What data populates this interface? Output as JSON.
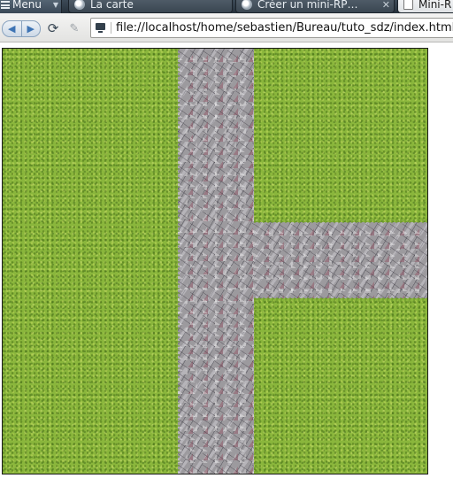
{
  "browser": {
    "menu_label": "Menu",
    "tabs": [
      {
        "label": "La carte",
        "icon": "page-icon",
        "active": false
      },
      {
        "label": "Créer un mini-RP…",
        "icon": "page-icon",
        "active": false
      },
      {
        "label": "Mini-R",
        "icon": "document-icon",
        "active": true
      }
    ],
    "toolbar": {
      "back_icon": "back-arrow-icon",
      "forward_icon": "forward-arrow-icon",
      "reload_icon": "reload-icon",
      "edit_icon": "edit-icon",
      "site_icon": "local-file-icon",
      "url": "file://localhost/home/sebastien/Bureau/tuto_sdz/index.html"
    }
  },
  "map": {
    "tiles": [
      "grass",
      "stone-path"
    ],
    "colors": {
      "grass": "#8ab63c",
      "stone": "#9c9a9e"
    }
  }
}
